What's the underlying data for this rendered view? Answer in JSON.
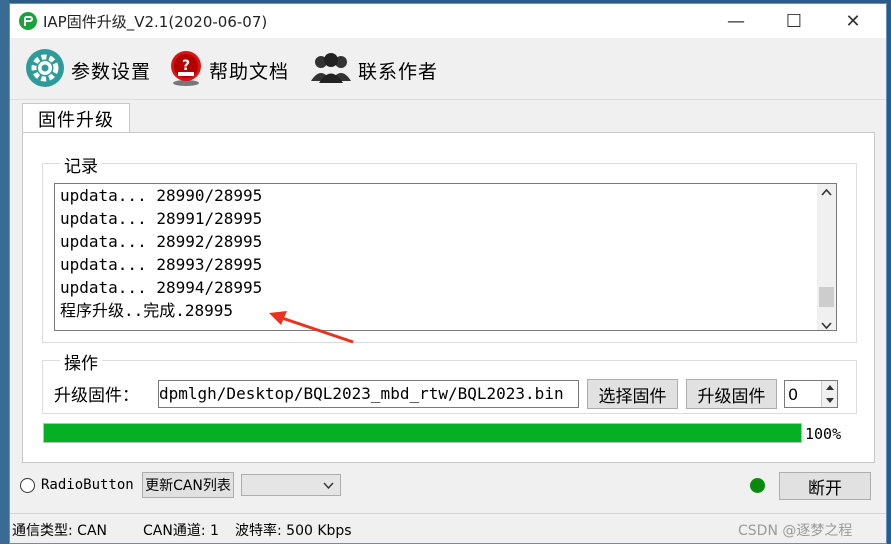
{
  "window": {
    "title": "IAP固件升级_V2.1(2020-06-07)",
    "minimize": "—",
    "maximize": "☐",
    "close": "✕"
  },
  "toolbar": {
    "settings_label": "参数设置",
    "help_label": "帮助文档",
    "contact_label": "联系作者"
  },
  "tabs": [
    {
      "label": "固件升级"
    }
  ],
  "log": {
    "group_label": "记录",
    "lines": [
      "updata...  28990/28995",
      "updata...  28991/28995",
      "updata...  28992/28995",
      "updata...  28993/28995",
      "updata...  28994/28995",
      "程序升级..完成.28995"
    ]
  },
  "operation": {
    "group_label": "操作",
    "firmware_label": "升级固件：",
    "firmware_path": "dpmlgh/Desktop/BQL2023_mbd_rtw/BQL2023.bin",
    "select_button": "选择固件",
    "upgrade_button": "升级固件",
    "spin_value": "0"
  },
  "progress": {
    "value": 100,
    "text": "100%"
  },
  "bottom": {
    "radio_label": "RadioButton",
    "refresh_can_button": "更新CAN列表",
    "can_select_value": "",
    "disconnect_button": "断开",
    "status_color": "#0a8a0a"
  },
  "statusbar": {
    "comm_type": "通信类型: CAN",
    "can_channel": "CAN通道: 1",
    "baud": "波特率: 500 Kbps"
  },
  "watermark": "CSDN @逐梦之程",
  "colors": {
    "progress": "#06b025",
    "arrow": "#e8321e"
  }
}
